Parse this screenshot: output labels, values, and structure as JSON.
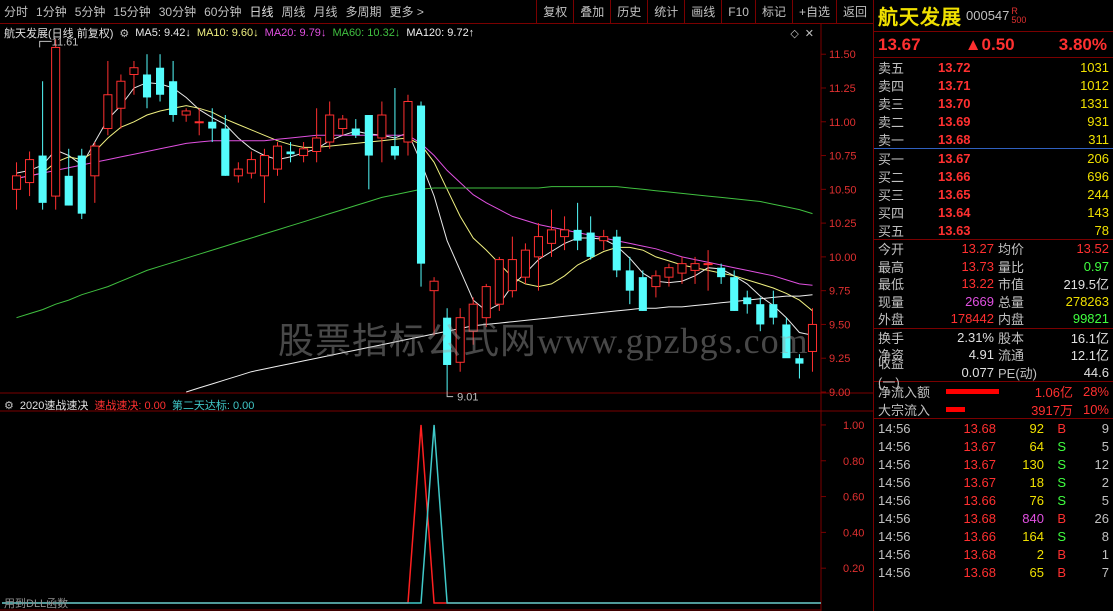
{
  "toolbar": {
    "periods": [
      "分时",
      "1分钟",
      "5分钟",
      "15分钟",
      "30分钟",
      "60分钟",
      "日线",
      "周线",
      "月线",
      "多周期",
      "更多 >"
    ],
    "active_period": "日线",
    "tools": [
      "复权",
      "叠加",
      "历史",
      "统计",
      "画线",
      "F10",
      "标记",
      "+自选",
      "返回"
    ]
  },
  "main_legend": {
    "title": "航天发展(日线 前复权)",
    "ma5": "MA5: 9.42↓",
    "ma10": "MA10: 9.60↓",
    "ma20": "MA20: 9.79↓",
    "ma60": "MA60: 10.32↓",
    "ma120": "MA120: 9.72↑"
  },
  "sub_legend": {
    "title": "2020速战速决",
    "line1": "速战速决: 0.00",
    "line2": "第二天达标: 0.00"
  },
  "annotations": {
    "high": "11.61",
    "low": "9.01"
  },
  "watermark": "股票指标公式网www.gpzbgs.com",
  "footer_note": "用到DLL函数",
  "colors": {
    "up": "#ff3030",
    "down": "#54fcfc",
    "ma5": "#e8e8e8",
    "ma10": "#f0f080",
    "ma20": "#e050e0",
    "ma60": "#40c040",
    "ma120": "#f0f0f0",
    "grid": "#7a0000"
  },
  "chart_data": [
    {
      "type": "candlestick",
      "ylim": [
        9.0,
        11.62
      ],
      "y_ticks": [
        "11.50",
        "11.25",
        "11.00",
        "10.75",
        "10.50",
        "10.25",
        "10.00",
        "9.75",
        "9.50",
        "9.25",
        "9.00"
      ],
      "y_tick_values": [
        11.5,
        11.25,
        11.0,
        10.75,
        10.5,
        10.25,
        10.0,
        9.75,
        9.5,
        9.25,
        9.0
      ],
      "candles": [
        [
          10.5,
          10.7,
          10.35,
          10.6
        ],
        [
          10.55,
          10.78,
          10.45,
          10.72
        ],
        [
          10.75,
          11.3,
          10.35,
          10.4
        ],
        [
          10.45,
          11.61,
          10.35,
          11.55
        ],
        [
          10.6,
          10.8,
          10.38,
          10.38
        ],
        [
          10.75,
          10.8,
          10.28,
          10.32
        ],
        [
          10.6,
          10.85,
          10.4,
          10.82
        ],
        [
          10.95,
          11.45,
          10.9,
          11.2
        ],
        [
          11.1,
          11.35,
          10.95,
          11.3
        ],
        [
          11.35,
          11.45,
          11.2,
          11.4
        ],
        [
          11.35,
          11.5,
          11.1,
          11.18
        ],
        [
          11.4,
          11.5,
          11.15,
          11.2
        ],
        [
          11.3,
          11.45,
          11.0,
          11.05
        ],
        [
          11.05,
          11.1,
          11.0,
          11.08
        ],
        [
          11.0,
          11.1,
          10.9,
          11.0
        ],
        [
          11.0,
          11.1,
          10.85,
          10.95
        ],
        [
          10.95,
          11.05,
          10.6,
          10.6
        ],
        [
          10.6,
          10.7,
          10.55,
          10.65
        ],
        [
          10.62,
          10.78,
          10.58,
          10.72
        ],
        [
          10.6,
          10.8,
          10.4,
          10.75
        ],
        [
          10.65,
          10.85,
          10.6,
          10.82
        ],
        [
          10.78,
          10.85,
          10.7,
          10.76
        ],
        [
          10.75,
          10.85,
          10.7,
          10.8
        ],
        [
          10.78,
          11.1,
          10.7,
          10.88
        ],
        [
          10.85,
          11.15,
          10.8,
          11.05
        ],
        [
          10.95,
          11.05,
          10.9,
          11.02
        ],
        [
          10.95,
          11.02,
          10.88,
          10.9
        ],
        [
          11.05,
          11.05,
          10.5,
          10.75
        ],
        [
          10.88,
          11.15,
          10.7,
          11.05
        ],
        [
          10.82,
          11.25,
          10.72,
          10.75
        ],
        [
          10.85,
          11.2,
          10.75,
          11.15
        ],
        [
          11.12,
          11.15,
          9.78,
          9.95
        ],
        [
          9.75,
          9.85,
          9.42,
          9.82
        ],
        [
          9.55,
          9.62,
          9.01,
          9.2
        ],
        [
          9.22,
          9.62,
          9.15,
          9.55
        ],
        [
          9.45,
          9.7,
          9.35,
          9.65
        ],
        [
          9.55,
          9.8,
          9.48,
          9.78
        ],
        [
          9.65,
          10.0,
          9.6,
          9.98
        ],
        [
          9.75,
          10.15,
          9.7,
          9.98
        ],
        [
          9.85,
          10.1,
          9.8,
          10.05
        ],
        [
          10.0,
          10.25,
          9.75,
          10.15
        ],
        [
          10.1,
          10.35,
          10.0,
          10.2
        ],
        [
          10.15,
          10.3,
          10.05,
          10.2
        ],
        [
          10.2,
          10.4,
          10.05,
          10.12
        ],
        [
          10.18,
          10.3,
          9.98,
          10.0
        ],
        [
          10.12,
          10.2,
          10.05,
          10.15
        ],
        [
          10.15,
          10.2,
          9.85,
          9.9
        ],
        [
          9.9,
          10.0,
          9.65,
          9.75
        ],
        [
          9.85,
          9.9,
          9.6,
          9.6
        ],
        [
          9.78,
          9.9,
          9.7,
          9.86
        ],
        [
          9.85,
          9.95,
          9.78,
          9.92
        ],
        [
          9.88,
          10.0,
          9.8,
          9.95
        ],
        [
          9.9,
          10.0,
          9.8,
          9.95
        ],
        [
          9.95,
          10.05,
          9.75,
          9.95
        ],
        [
          9.92,
          9.95,
          9.8,
          9.85
        ],
        [
          9.85,
          9.9,
          9.6,
          9.6
        ],
        [
          9.7,
          9.75,
          9.58,
          9.65
        ],
        [
          9.65,
          9.7,
          9.45,
          9.5
        ],
        [
          9.65,
          9.75,
          9.5,
          9.55
        ],
        [
          9.5,
          9.55,
          9.3,
          9.25
        ],
        [
          9.25,
          9.28,
          9.1,
          9.21
        ],
        [
          9.3,
          9.62,
          9.15,
          9.5
        ]
      ],
      "series": [
        {
          "name": "MA5",
          "values": [
            10.62,
            10.64,
            10.68,
            10.79,
            10.75,
            10.68,
            10.85,
            11.02,
            11.12,
            11.25,
            11.29,
            11.28,
            11.25,
            11.18,
            11.09,
            11.03,
            10.98,
            10.88,
            10.8,
            10.75,
            10.72,
            10.74,
            10.77,
            10.8,
            10.86,
            10.9,
            10.93,
            10.91,
            10.9,
            10.88,
            10.92,
            10.7,
            10.45,
            10.12,
            9.9,
            9.68,
            9.6,
            9.65,
            9.79,
            9.88,
            9.98,
            10.04,
            10.1,
            10.14,
            10.14,
            10.13,
            10.08,
            9.99,
            9.88,
            9.82,
            9.81,
            9.82,
            9.86,
            9.92,
            9.91,
            9.86,
            9.8,
            9.71,
            9.64,
            9.55,
            9.44,
            9.42
          ]
        },
        {
          "name": "MA10",
          "values": [
            10.58,
            10.6,
            10.62,
            10.7,
            10.74,
            10.72,
            10.78,
            10.88,
            10.96,
            11.0,
            11.05,
            11.08,
            11.1,
            11.12,
            11.1,
            11.07,
            11.02,
            10.98,
            10.94,
            10.9,
            10.86,
            10.83,
            10.81,
            10.81,
            10.82,
            10.83,
            10.84,
            10.85,
            10.86,
            10.87,
            10.88,
            10.83,
            10.7,
            10.5,
            10.3,
            10.14,
            10.05,
            9.95,
            9.85,
            9.8,
            9.78,
            9.8,
            9.86,
            9.94,
            9.99,
            10.04,
            10.07,
            10.07,
            10.05,
            10.0,
            9.97,
            9.94,
            9.92,
            9.9,
            9.88,
            9.86,
            9.83,
            9.8,
            9.77,
            9.73,
            9.68,
            9.6
          ]
        },
        {
          "name": "MA20",
          "values": [
            10.58,
            10.6,
            10.62,
            10.64,
            10.66,
            10.68,
            10.7,
            10.72,
            10.74,
            10.76,
            10.78,
            10.8,
            10.82,
            10.84,
            10.85,
            10.86,
            10.86,
            10.86,
            10.86,
            10.86,
            10.87,
            10.88,
            10.89,
            10.9,
            10.9,
            10.9,
            10.9,
            10.9,
            10.9,
            10.9,
            10.9,
            10.84,
            10.75,
            10.64,
            10.55,
            10.46,
            10.4,
            10.35,
            10.3,
            10.27,
            10.24,
            10.22,
            10.2,
            10.18,
            10.16,
            10.14,
            10.12,
            10.1,
            10.08,
            10.06,
            10.03,
            10.0,
            9.98,
            9.96,
            9.94,
            9.92,
            9.9,
            9.88,
            9.86,
            9.83,
            9.8,
            9.79
          ]
        },
        {
          "name": "MA60",
          "values": [
            9.55,
            9.58,
            9.61,
            9.65,
            9.68,
            9.72,
            9.75,
            9.78,
            9.82,
            9.86,
            9.9,
            9.93,
            9.96,
            9.99,
            10.02,
            10.05,
            10.08,
            10.11,
            10.14,
            10.17,
            10.2,
            10.23,
            10.26,
            10.29,
            10.32,
            10.35,
            10.38,
            10.41,
            10.44,
            10.46,
            10.48,
            10.5,
            10.51,
            10.51,
            10.51,
            10.51,
            10.51,
            10.51,
            10.51,
            10.51,
            10.51,
            10.52,
            10.52,
            10.52,
            10.52,
            10.52,
            10.52,
            10.51,
            10.5,
            10.49,
            10.48,
            10.47,
            10.46,
            10.45,
            10.44,
            10.43,
            10.42,
            10.41,
            10.39,
            10.37,
            10.35,
            10.32
          ]
        },
        {
          "name": "MA120",
          "values": [
            null,
            null,
            null,
            null,
            null,
            null,
            null,
            null,
            null,
            null,
            null,
            null,
            null,
            9.0,
            9.03,
            9.06,
            9.09,
            9.12,
            9.15,
            9.17,
            9.19,
            9.21,
            9.23,
            9.25,
            9.27,
            9.29,
            9.31,
            9.33,
            9.35,
            9.37,
            9.39,
            9.41,
            9.43,
            9.45,
            9.47,
            9.49,
            9.5,
            9.51,
            9.52,
            9.53,
            9.54,
            9.55,
            9.56,
            9.57,
            9.58,
            9.59,
            9.6,
            9.61,
            9.62,
            9.62,
            9.63,
            9.63,
            9.64,
            9.65,
            9.66,
            9.67,
            9.68,
            9.69,
            9.7,
            9.71,
            9.71,
            9.72
          ]
        }
      ]
    },
    {
      "type": "line",
      "ylim": [
        0,
        1.05
      ],
      "y_ticks": [
        "1.00",
        "0.80",
        "0.60",
        "0.40",
        "0.20"
      ],
      "y_tick_values": [
        1.0,
        0.8,
        0.6,
        0.4,
        0.2
      ],
      "series": [
        {
          "name": "速战速决",
          "color": "#ff2020",
          "spike_index": 31
        },
        {
          "name": "第二天达标",
          "color": "#40c8c8",
          "spike_index": 32
        }
      ]
    }
  ],
  "panel": {
    "name": "航天发展",
    "code": "000547",
    "badge_top": "R",
    "badge_bottom": "500",
    "price": "13.67",
    "change": "▲0.50",
    "change_pct": "3.80%",
    "asks": [
      {
        "label": "卖五",
        "price": "13.72",
        "vol": "1031"
      },
      {
        "label": "卖四",
        "price": "13.71",
        "vol": "1012"
      },
      {
        "label": "卖三",
        "price": "13.70",
        "vol": "1331"
      },
      {
        "label": "卖二",
        "price": "13.69",
        "vol": "931"
      },
      {
        "label": "卖一",
        "price": "13.68",
        "vol": "311"
      }
    ],
    "bids": [
      {
        "label": "买一",
        "price": "13.67",
        "vol": "206"
      },
      {
        "label": "买二",
        "price": "13.66",
        "vol": "696"
      },
      {
        "label": "买三",
        "price": "13.65",
        "vol": "244"
      },
      {
        "label": "买四",
        "price": "13.64",
        "vol": "143"
      },
      {
        "label": "买五",
        "price": "13.63",
        "vol": "78"
      }
    ],
    "stats1": [
      {
        "l1": "今开",
        "v1": "13.27",
        "c1": "#ff3030",
        "l2": "均价",
        "v2": "13.52",
        "c2": "#ff3030"
      },
      {
        "l1": "最高",
        "v1": "13.73",
        "c1": "#ff3030",
        "l2": "量比",
        "v2": "0.97",
        "c2": "#40ff40"
      },
      {
        "l1": "最低",
        "v1": "13.22",
        "c1": "#ff3030",
        "l2": "市值",
        "v2": "219.5亿",
        "c2": "#e0e0e0"
      },
      {
        "l1": "现量",
        "v1": "2669",
        "c1": "#e050e0",
        "l2": "总量",
        "v2": "278263",
        "c2": "#f0e000"
      },
      {
        "l1": "外盘",
        "v1": "178442",
        "c1": "#ff3030",
        "l2": "内盘",
        "v2": "99821",
        "c2": "#40ff40"
      }
    ],
    "stats2": [
      {
        "l1": "换手",
        "v1": "2.31%",
        "c1": "#e0e0e0",
        "l2": "股本",
        "v2": "16.1亿",
        "c2": "#e0e0e0"
      },
      {
        "l1": "净资",
        "v1": "4.91",
        "c1": "#e0e0e0",
        "l2": "流通",
        "v2": "12.1亿",
        "c2": "#e0e0e0"
      },
      {
        "l1": "收益(一)",
        "v1": "0.077",
        "c1": "#e0e0e0",
        "l2": "PE(动)",
        "v2": "44.6",
        "c2": "#e0e0e0"
      }
    ],
    "flows": [
      {
        "label": "净流入额",
        "bar_pct": 28,
        "value": "1.06亿",
        "pct": "28%"
      },
      {
        "label": "大宗流入",
        "bar_pct": 10,
        "value": "3917万",
        "pct": "10%"
      }
    ],
    "ticks": [
      {
        "time": "14:56",
        "price": "13.68",
        "vol": "92",
        "vc": "#f0e000",
        "dir": "B",
        "dc": "#ff3030",
        "n": "9"
      },
      {
        "time": "14:56",
        "price": "13.67",
        "vol": "64",
        "vc": "#f0e000",
        "dir": "S",
        "dc": "#40ff40",
        "n": "5"
      },
      {
        "time": "14:56",
        "price": "13.67",
        "vol": "130",
        "vc": "#f0e000",
        "dir": "S",
        "dc": "#40ff40",
        "n": "12"
      },
      {
        "time": "14:56",
        "price": "13.67",
        "vol": "18",
        "vc": "#f0e000",
        "dir": "S",
        "dc": "#40ff40",
        "n": "2"
      },
      {
        "time": "14:56",
        "price": "13.66",
        "vol": "76",
        "vc": "#f0e000",
        "dir": "S",
        "dc": "#40ff40",
        "n": "5"
      },
      {
        "time": "14:56",
        "price": "13.68",
        "vol": "840",
        "vc": "#e050e0",
        "dir": "B",
        "dc": "#ff3030",
        "n": "26"
      },
      {
        "time": "14:56",
        "price": "13.66",
        "vol": "164",
        "vc": "#f0e000",
        "dir": "S",
        "dc": "#40ff40",
        "n": "8"
      },
      {
        "time": "14:56",
        "price": "13.68",
        "vol": "2",
        "vc": "#f0e000",
        "dir": "B",
        "dc": "#ff3030",
        "n": "1"
      },
      {
        "time": "14:56",
        "price": "13.68",
        "vol": "65",
        "vc": "#f0e000",
        "dir": "B",
        "dc": "#ff3030",
        "n": "7"
      }
    ]
  }
}
